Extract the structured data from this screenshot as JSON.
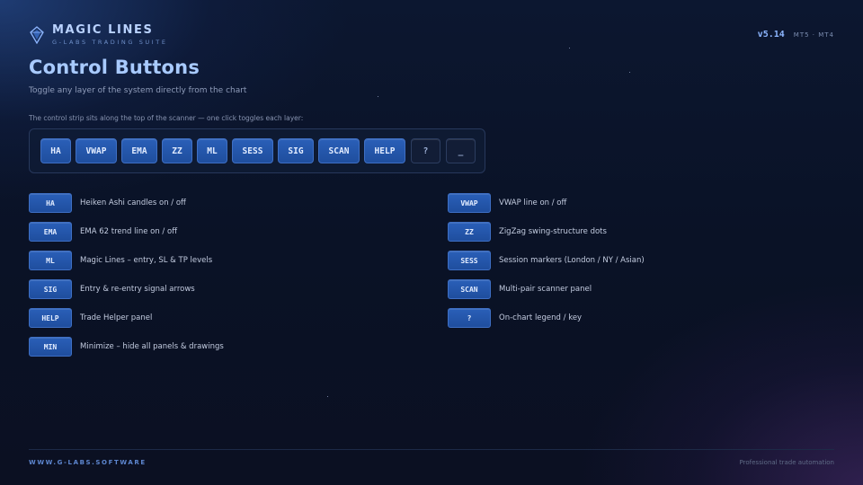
{
  "brand": {
    "title": "MAGIC LINES",
    "subtitle": "G-LABS TRADING SUITE",
    "icon": "diamond-logo-icon"
  },
  "version": {
    "number": "v5.14",
    "platforms": "MT5 · MT4"
  },
  "page": {
    "title": "Control Buttons",
    "subtitle": "Toggle any layer of the system directly from the chart",
    "strip_caption": "The control strip sits along the top of the scanner — one click toggles each layer:"
  },
  "strip": {
    "buttons": [
      {
        "label": "HA",
        "style": "primary"
      },
      {
        "label": "VWAP",
        "style": "primary"
      },
      {
        "label": "EMA",
        "style": "primary"
      },
      {
        "label": "ZZ",
        "style": "primary"
      },
      {
        "label": "ML",
        "style": "primary"
      },
      {
        "label": "SESS",
        "style": "primary"
      },
      {
        "label": "SIG",
        "style": "primary"
      },
      {
        "label": "SCAN",
        "style": "primary"
      },
      {
        "label": "HELP",
        "style": "primary"
      },
      {
        "label": "?",
        "style": "dark"
      },
      {
        "label": "_",
        "style": "dark"
      }
    ]
  },
  "legend": {
    "left": [
      {
        "key": "HA",
        "desc": "Heiken Ashi candles on / off"
      },
      {
        "key": "EMA",
        "desc": "EMA 62 trend line on / off"
      },
      {
        "key": "ML",
        "desc": "Magic Lines – entry, SL & TP levels"
      },
      {
        "key": "SIG",
        "desc": "Entry & re-entry signal arrows"
      },
      {
        "key": "HELP",
        "desc": "Trade Helper panel"
      },
      {
        "key": "MIN",
        "desc": "Minimize – hide all panels & drawings"
      }
    ],
    "right": [
      {
        "key": "VWAP",
        "desc": "VWAP line on / off"
      },
      {
        "key": "ZZ",
        "desc": "ZigZag swing-structure dots"
      },
      {
        "key": "SESS",
        "desc": "Session markers (London / NY / Asian)"
      },
      {
        "key": "SCAN",
        "desc": "Multi-pair scanner panel"
      },
      {
        "key": "?",
        "desc": "On-chart legend / key"
      }
    ]
  },
  "footer": {
    "website": "WWW.G-LABS.SOFTWARE",
    "tagline": "Professional trade automation"
  },
  "colors": {
    "accent": "#2a5fb8",
    "title": "#a8caff",
    "background": "#0b1226"
  }
}
